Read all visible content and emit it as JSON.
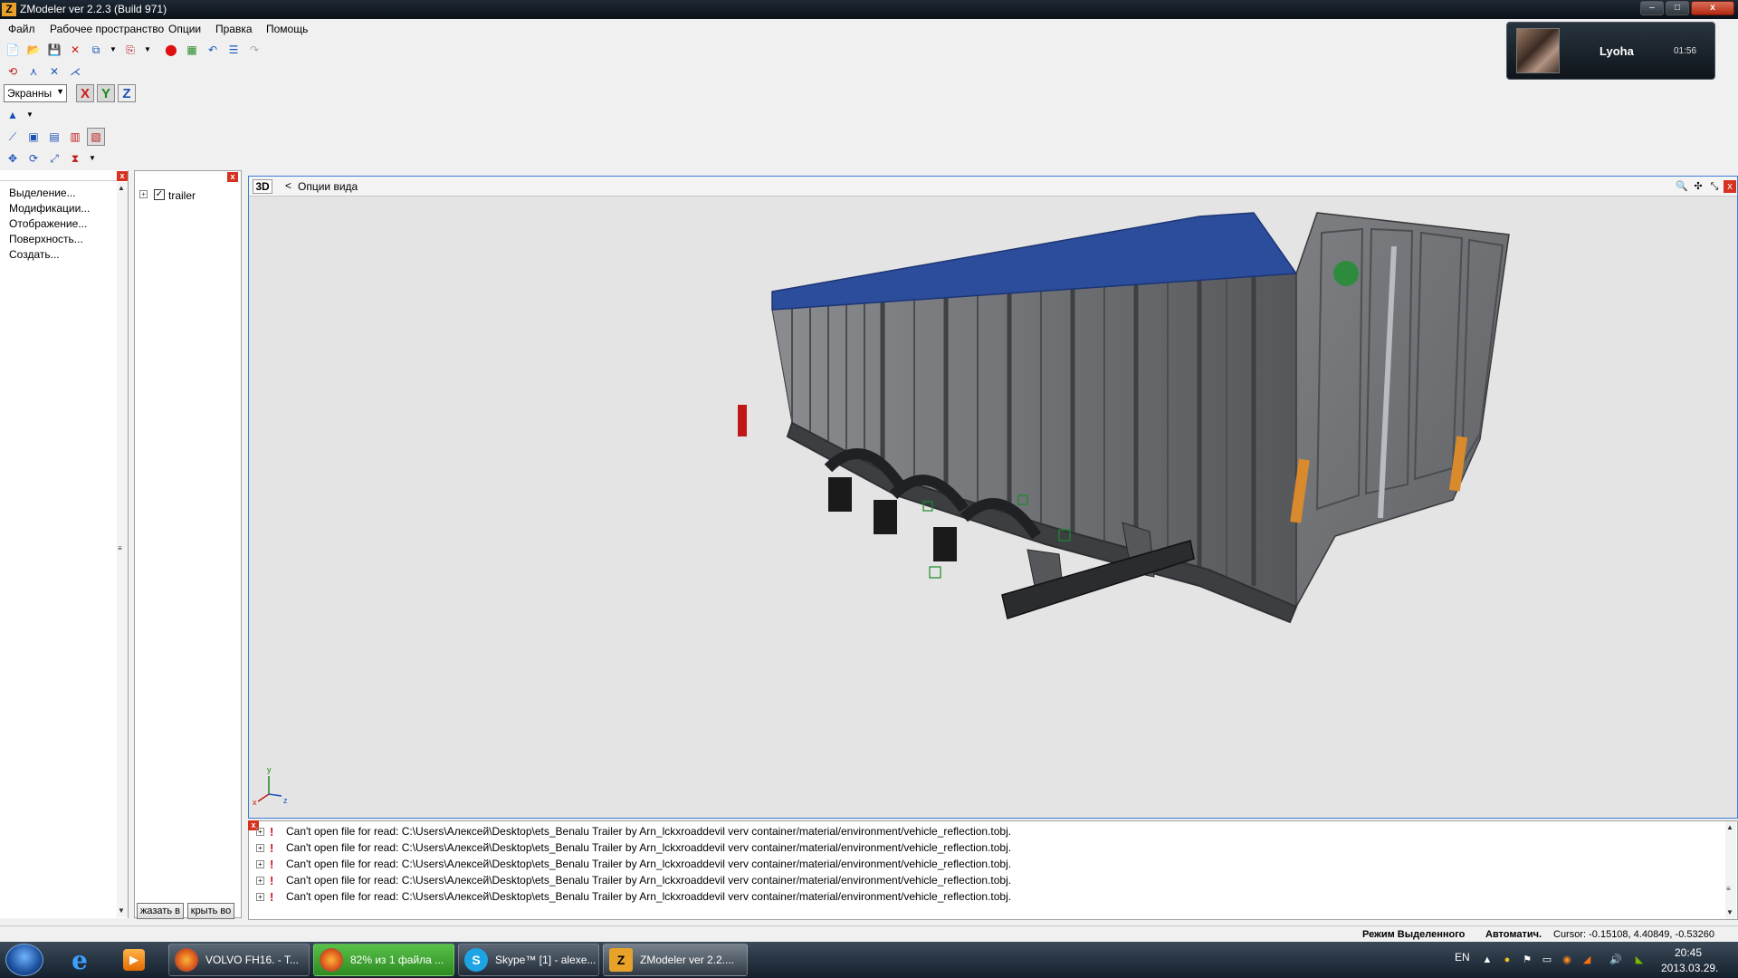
{
  "window": {
    "title": "ZModeler ver 2.2.3 (Build 971)",
    "buttons": {
      "minimize": "–",
      "maximize": "□",
      "close": "x"
    }
  },
  "menu": [
    "Файл",
    "Рабочее пространство",
    "Опции",
    "Правка",
    "Помощь"
  ],
  "toolbar": {
    "view_select": "Экранны",
    "axes": [
      "X",
      "Y",
      "Z"
    ]
  },
  "overlay": {
    "name": "Lyoha",
    "time": "01:56"
  },
  "left_panel": {
    "items": [
      "Выделение...",
      "Модификации...",
      "Отображение...",
      "Поверхность...",
      "Создать..."
    ]
  },
  "tree_panel": {
    "root_label": "trailer",
    "checked": true,
    "buttons": [
      "жазать в",
      "крыть во"
    ]
  },
  "viewport": {
    "mode": "3D",
    "back": "<",
    "options_label": "Опции вида",
    "axis_labels": {
      "x": "x",
      "y": "y",
      "z": "z"
    }
  },
  "log": {
    "entries": [
      "Can't open file for read: C:\\Users\\Алексей\\Desktop\\ets_Benalu Trailer by Arn_lckxroaddevil verv container/material/environment/vehicle_reflection.tobj.",
      "Can't open file for read: C:\\Users\\Алексей\\Desktop\\ets_Benalu Trailer by Arn_lckxroaddevil verv container/material/environment/vehicle_reflection.tobj.",
      "Can't open file for read: C:\\Users\\Алексей\\Desktop\\ets_Benalu Trailer by Arn_lckxroaddevil verv container/material/environment/vehicle_reflection.tobj.",
      "Can't open file for read: C:\\Users\\Алексей\\Desktop\\ets_Benalu Trailer by Arn_lckxroaddevil verv container/material/environment/vehicle_reflection.tobj.",
      "Can't open file for read: C:\\Users\\Алексей\\Desktop\\ets_Benalu Trailer by Arn_lckxroaddevil verv container/material/environment/vehicle_reflection.tobj."
    ]
  },
  "status": {
    "mode": "Режим Выделенного",
    "auto": "Автоматич.",
    "cursor": "Cursor: -0.15108, 4.40849, -0.53260"
  },
  "taskbar": {
    "tasks": [
      {
        "label": "VOLVO FH16. - T...",
        "icon": "firefox-icon"
      },
      {
        "label": "82% из 1 файла ...",
        "icon": "firefox-download-icon"
      },
      {
        "label": "Skype™ [1] - alexe...",
        "icon": "skype-icon"
      },
      {
        "label": "ZModeler ver 2.2....",
        "icon": "zmodeler-icon"
      }
    ],
    "lang": "EN",
    "time": "20:45",
    "date": "2013.03.29."
  },
  "colors": {
    "tarp": "#2b4d9c",
    "body": "#6e7074",
    "viewport_bg": "#e4e4e4",
    "viewport_border": "#3d7dd6"
  }
}
